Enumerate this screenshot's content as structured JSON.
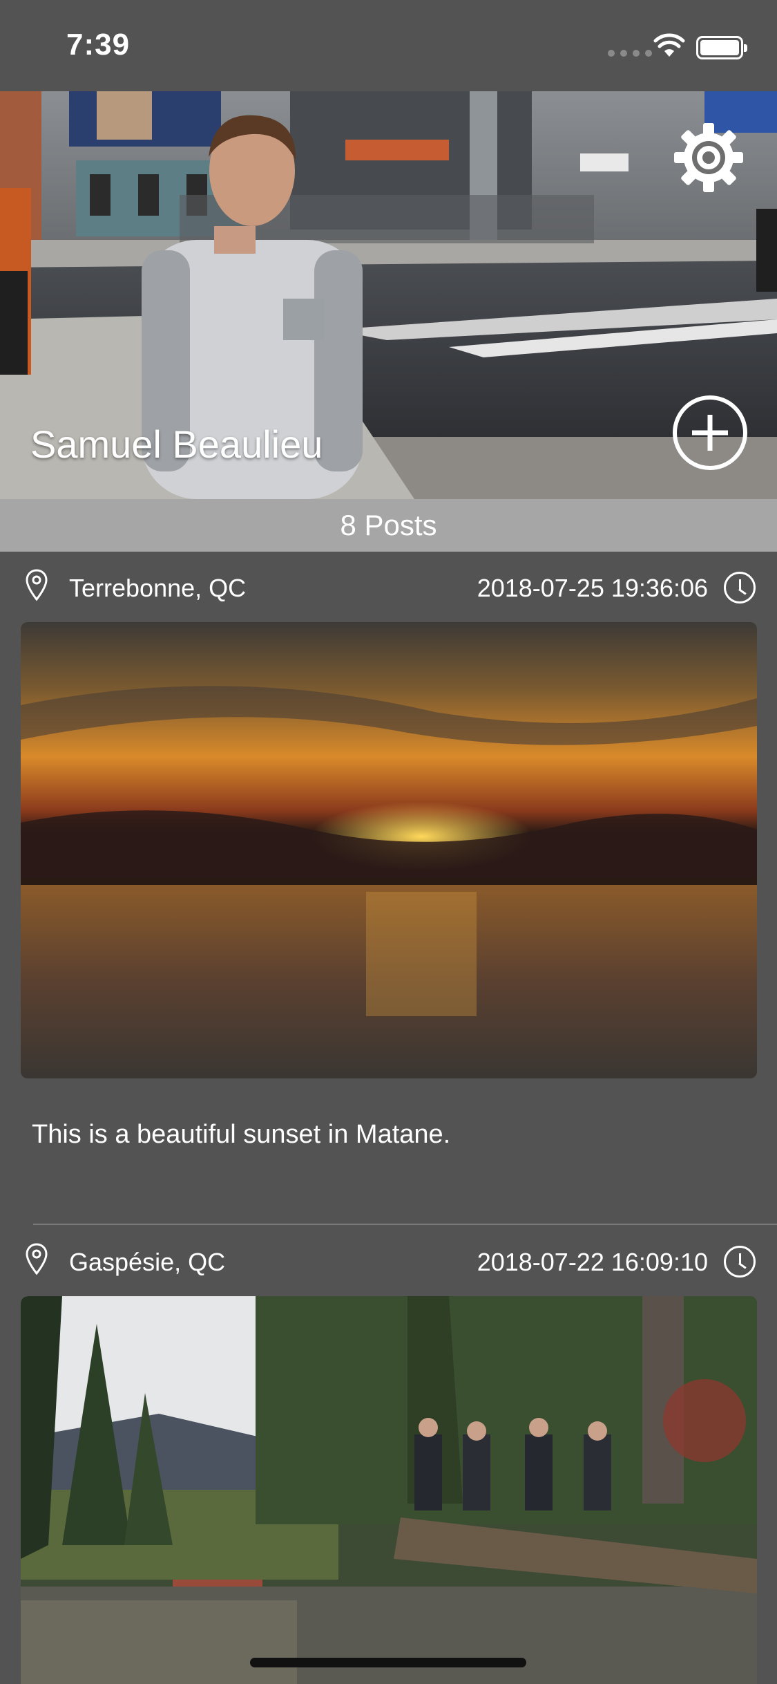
{
  "status_bar": {
    "time": "7:39"
  },
  "profile": {
    "name": "Samuel Beaulieu",
    "posts_count_label": "8 Posts",
    "settings_icon": "gear-icon",
    "add_icon": "plus-circle-icon"
  },
  "posts": [
    {
      "location": "Terrebonne, QC",
      "datetime": "2018-07-25 19:36:06",
      "caption": "This is a beautiful sunset in Matane.",
      "image": "sunset-over-water-photo"
    },
    {
      "location": "Gaspésie, QC",
      "datetime": "2018-07-22 16:09:10",
      "caption": "",
      "image": "friends-on-log-forest-river-photo"
    }
  ],
  "colors": {
    "background": "#535353",
    "posts_bar": "#a6a6a6",
    "divider": "#7a7a7a"
  }
}
